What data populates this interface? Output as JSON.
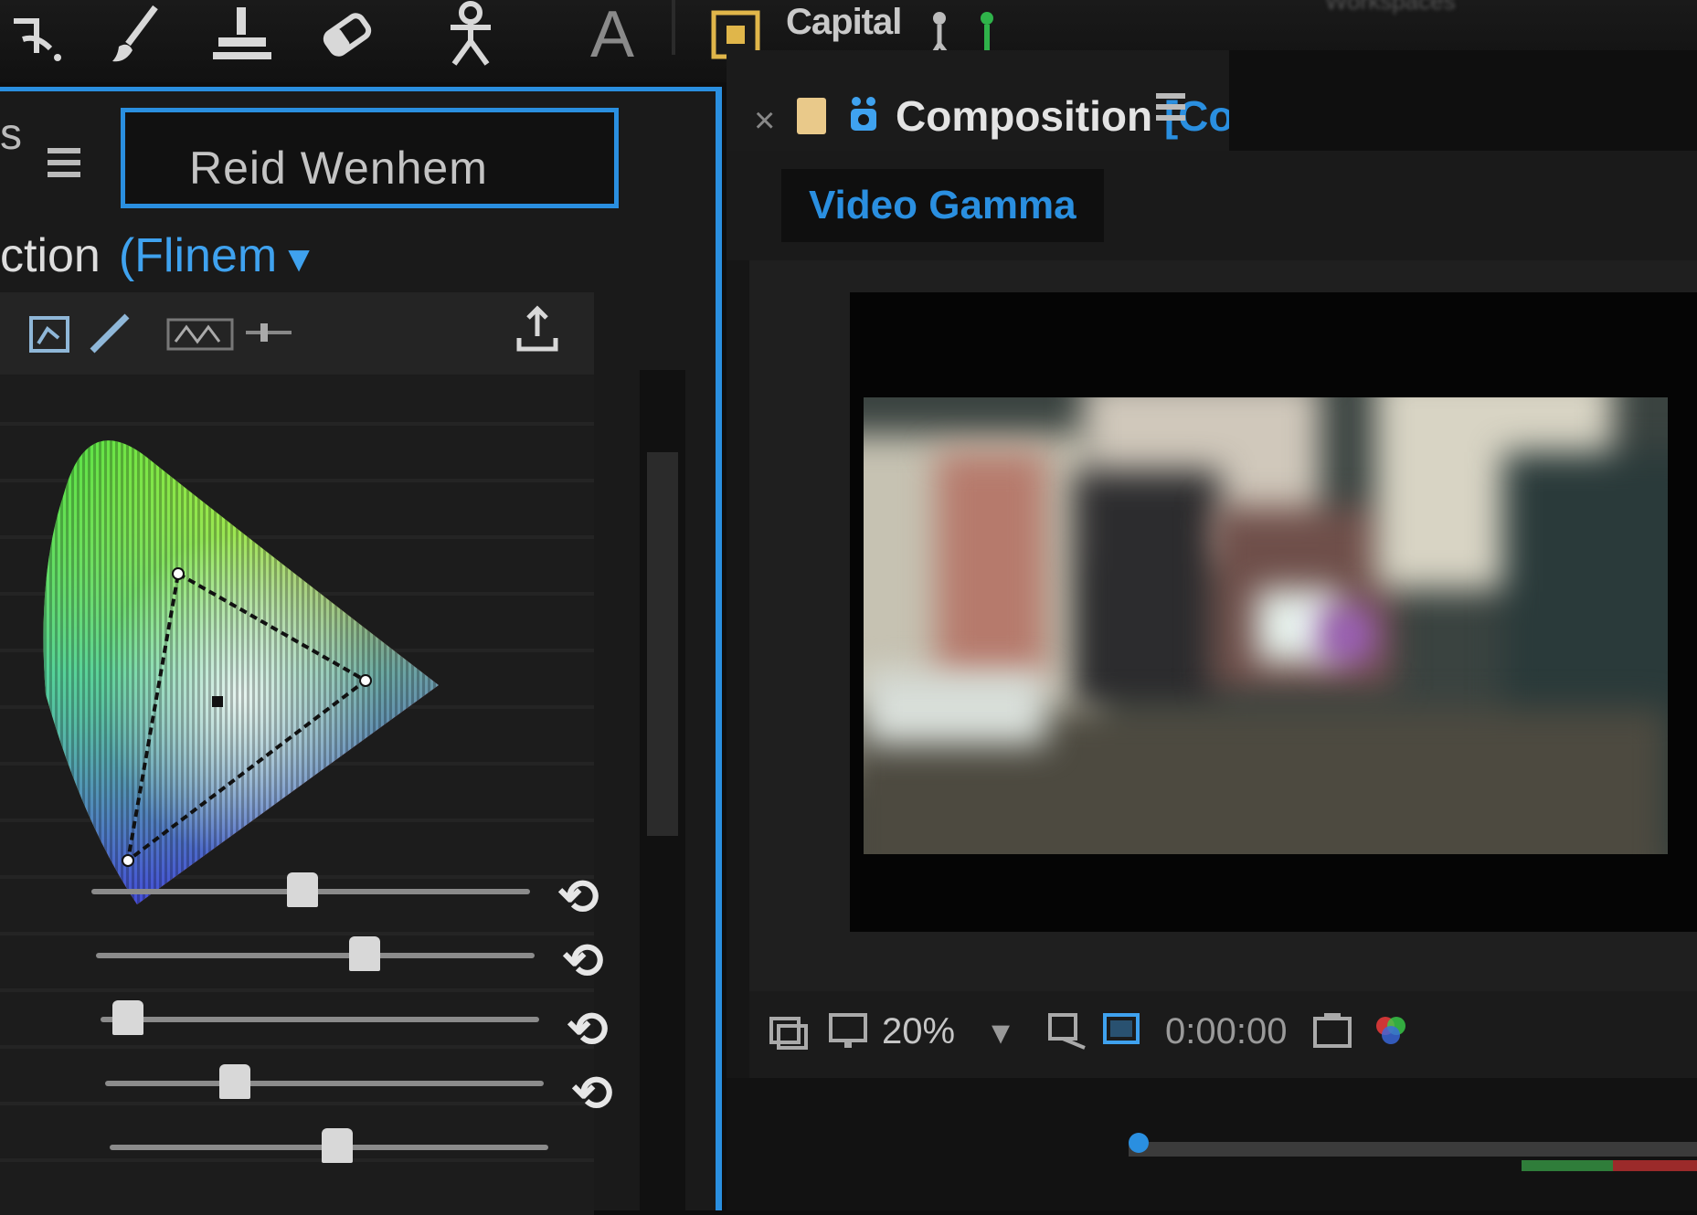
{
  "toolbar": {
    "tools": [
      {
        "name": "pen-tool-icon"
      },
      {
        "name": "brush-tool-icon"
      },
      {
        "name": "clone-stamp-tool-icon"
      },
      {
        "name": "eraser-tool-icon"
      },
      {
        "name": "puppet-pin-tool-icon"
      },
      {
        "name": "type-tool-icon",
        "glyph": "A"
      }
    ],
    "capital_label": "Capital",
    "workspace_label": "Workspaces"
  },
  "effects_panel": {
    "tab_fragment": "s",
    "title": "Reid Wenhem",
    "effect_label": "ction",
    "effect_mode": "(Flinem",
    "sliders": [
      {
        "value": 0.48
      },
      {
        "value": 0.62
      },
      {
        "value": 0.03
      },
      {
        "value": 0.28
      },
      {
        "value": 0.52
      }
    ]
  },
  "composition_panel": {
    "title": "Composition",
    "title_suffix": "[Control]",
    "view_tab": "Video Gamma",
    "zoom": "20%",
    "timecode": "0:00:00"
  },
  "colors": {
    "accent": "#2a8fe0",
    "panel_bg": "#1a1a1a",
    "app_bg": "#0e0e0e"
  }
}
